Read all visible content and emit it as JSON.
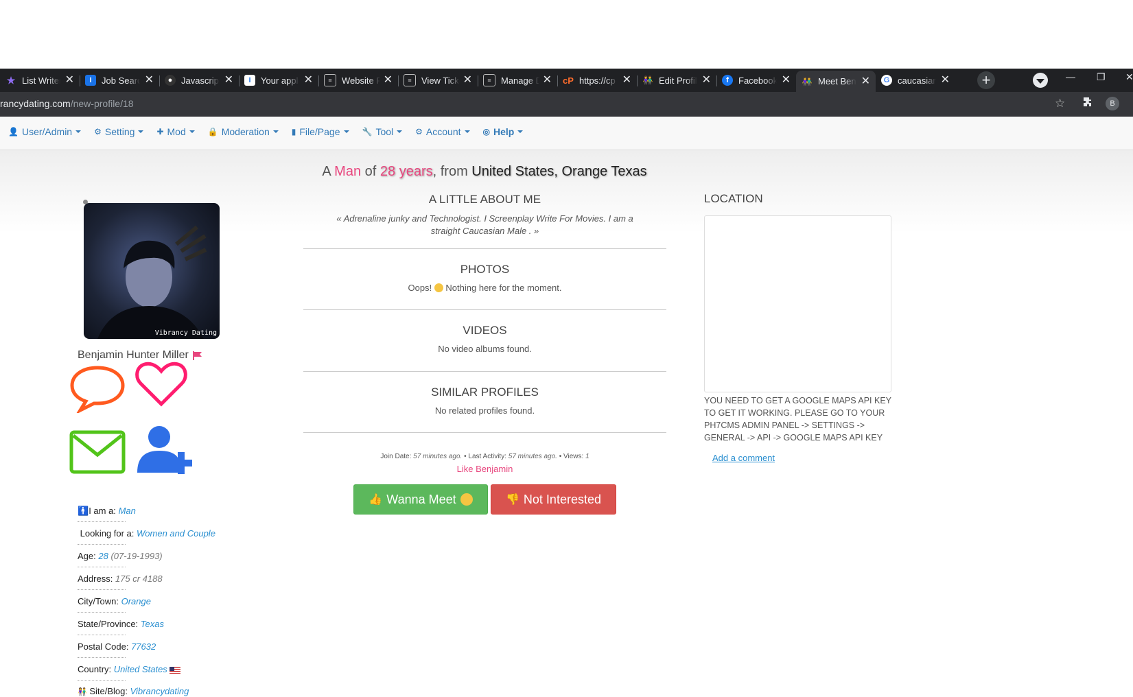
{
  "browser": {
    "tabs": [
      {
        "title": "List Writer",
        "icon": "star-icon",
        "active": false
      },
      {
        "title": "Job Search",
        "icon": "info-icon",
        "active": false
      },
      {
        "title": "Javascript",
        "icon": "github-icon",
        "active": false
      },
      {
        "title": "Your applic",
        "icon": "info-icon",
        "active": false
      },
      {
        "title": "Website R",
        "icon": "page-icon",
        "active": false
      },
      {
        "title": "View Ticke",
        "icon": "page-icon",
        "active": false
      },
      {
        "title": "Manage D",
        "icon": "page-icon",
        "active": false
      },
      {
        "title": "https://cp",
        "icon": "cpanel-icon",
        "active": false
      },
      {
        "title": "Edit Profile",
        "icon": "couple-icon",
        "active": false
      },
      {
        "title": "Facebook",
        "icon": "facebook-icon",
        "active": false
      },
      {
        "title": "Meet Benj",
        "icon": "couple-icon",
        "active": true
      },
      {
        "title": "caucasian",
        "icon": "google-icon",
        "active": false
      }
    ],
    "new_tab_label": "+",
    "url_host": "rancydating.com",
    "url_path": "/new-profile/18",
    "profile_initial": "B"
  },
  "admin_menu": [
    {
      "label": "User/Admin",
      "icon": "user-icon"
    },
    {
      "label": "Setting",
      "icon": "gear-icon"
    },
    {
      "label": "Mod",
      "icon": "puzzle-icon"
    },
    {
      "label": "Moderation",
      "icon": "lock-icon"
    },
    {
      "label": "File/Page",
      "icon": "file-icon"
    },
    {
      "label": "Tool",
      "icon": "wrench-icon"
    },
    {
      "label": "Account",
      "icon": "cog-icon"
    },
    {
      "label": "Help",
      "icon": "lifebuoy-icon"
    }
  ],
  "headline": {
    "a": "A",
    "sex": "Man",
    "of": "of",
    "age": "28 years",
    "from": ", from",
    "place": "United States, Orange Texas"
  },
  "profile": {
    "name": "Benjamin Hunter Miller",
    "watermark": "Vibrancy Dating",
    "info": [
      {
        "label": "I am a:",
        "value": "Man",
        "extra": ""
      },
      {
        "label": "Looking for a:",
        "value": "Women and Couple",
        "extra": ""
      },
      {
        "label": "Age:",
        "value": "28",
        "extra": "(07-19-1993)"
      },
      {
        "label": "Address:",
        "value": "175 cr 4188",
        "extra": ""
      },
      {
        "label": "City/Town:",
        "value": "Orange",
        "extra": ""
      },
      {
        "label": "State/Province:",
        "value": "Texas",
        "extra": ""
      },
      {
        "label": "Postal Code:",
        "value": "77632",
        "extra": ""
      },
      {
        "label": "Country:",
        "value": "United States",
        "extra": ""
      },
      {
        "label": "Site/Blog:",
        "value": "Vibrancydating",
        "extra": ""
      }
    ]
  },
  "sections": {
    "about_title": "A LITTLE ABOUT ME",
    "about_body": "« Adrenaline junky and Technologist. I Screenplay Write For Movies. I am a straight Caucasian Male . »",
    "photos_title": "PHOTOS",
    "photos_body_pre": "Oops!",
    "photos_body_post": "Nothing here for the moment.",
    "videos_title": "VIDEOS",
    "videos_body": "No video albums found.",
    "similar_title": "SIMILAR PROFILES",
    "similar_body": "No related profiles found."
  },
  "meta": {
    "join_label": "Join Date:",
    "join_value": "57 minutes ago.",
    "activity_label": "• Last Activity:",
    "activity_value": "57 minutes ago.",
    "views_label": "• Views:",
    "views_value": "1"
  },
  "like_text": "Like Benjamin",
  "buttons": {
    "meet": "Wanna Meet",
    "not_interested": "Not Interested"
  },
  "location": {
    "title": "LOCATION",
    "note": "YOU NEED TO GET A GOOGLE MAPS API KEY TO GET IT WORKING. PLEASE GO TO YOUR PH7CMS ADMIN PANEL -> SETTINGS -> GENERAL -> API -> GOOGLE MAPS API KEY",
    "add_comment": "Add a comment"
  },
  "colors": {
    "accent_pink": "#e8467e",
    "link_blue": "#2a8fd0",
    "meet_green": "#5cb85c",
    "no_red": "#d9534f",
    "chat_icon": "#ff5a1f",
    "heart_icon": "#ff1d6f",
    "mail_icon": "#52c41a",
    "adduser_icon": "#2f6fe6"
  }
}
